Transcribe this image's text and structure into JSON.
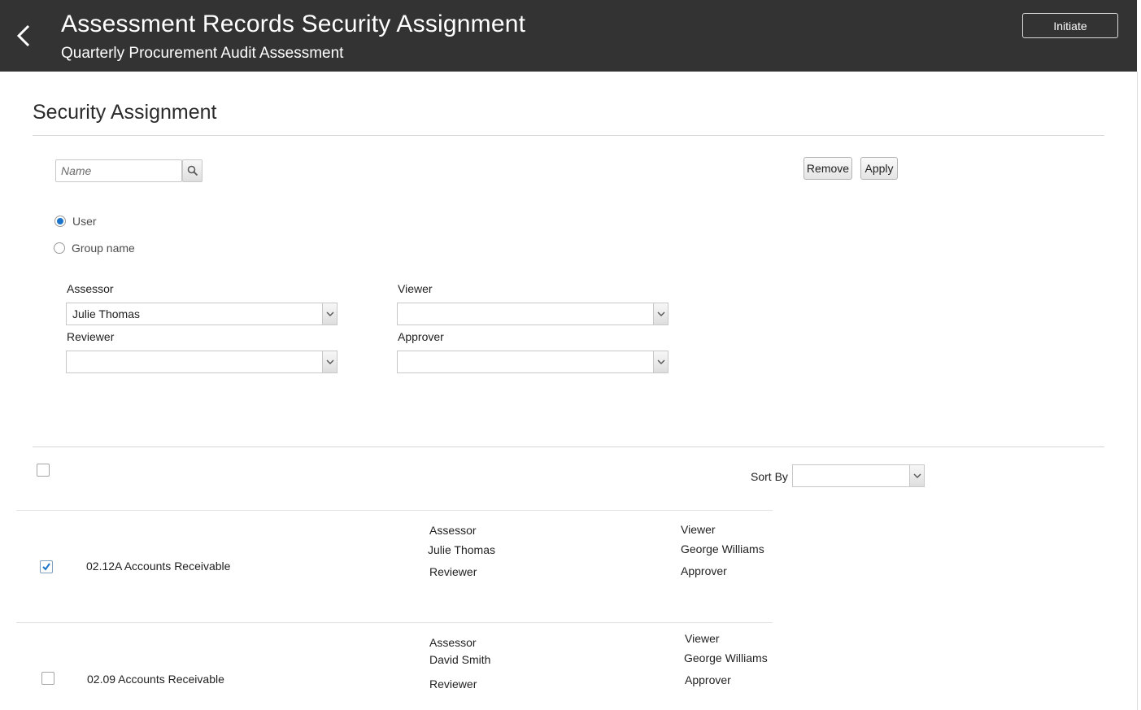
{
  "header": {
    "title": "Assessment Records Security Assignment",
    "subtitle": "Quarterly Procurement Audit Assessment",
    "initiate_label": "Initiate",
    "background_color": "#333333"
  },
  "section": {
    "title": "Security Assignment"
  },
  "search": {
    "placeholder": "Name"
  },
  "actions": {
    "remove_label": "Remove",
    "apply_label": "Apply"
  },
  "assign_type": {
    "options": [
      {
        "label": "User",
        "selected": true
      },
      {
        "label": "Group name",
        "selected": false
      }
    ]
  },
  "fields": {
    "assessor": {
      "label": "Assessor",
      "value": "Julie Thomas"
    },
    "viewer": {
      "label": "Viewer",
      "value": ""
    },
    "reviewer": {
      "label": "Reviewer",
      "value": ""
    },
    "approver": {
      "label": "Approver",
      "value": ""
    }
  },
  "list": {
    "sort_by_label": "Sort By",
    "sort_by_value": "",
    "select_all_checked": false,
    "rows": [
      {
        "name": "02.12A Accounts Receivable",
        "checked": true,
        "assessor_label": "Assessor",
        "assessor": "Julie Thomas",
        "reviewer_label": "Reviewer",
        "reviewer": "",
        "viewer_label": "Viewer",
        "viewer": "George Williams",
        "approver_label": "Approver",
        "approver": ""
      },
      {
        "name": "02.09 Accounts Receivable",
        "checked": false,
        "assessor_label": "Assessor",
        "assessor": "David Smith",
        "reviewer_label": "Reviewer",
        "reviewer": "",
        "viewer_label": "Viewer",
        "viewer": "George Williams",
        "approver_label": "Approver",
        "approver": ""
      }
    ]
  },
  "colors": {
    "accent": "#1a73c8"
  }
}
